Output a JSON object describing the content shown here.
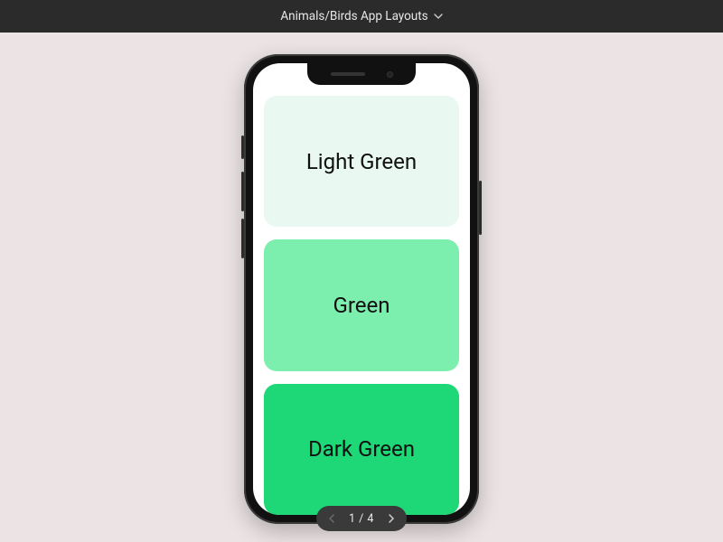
{
  "header": {
    "title": "Animals/Birds App Layouts"
  },
  "cards": [
    {
      "label": "Light Green",
      "color": "#e9f9f1"
    },
    {
      "label": "Green",
      "color": "#7ceeae"
    },
    {
      "label": "Dark Green",
      "color": "#1ed776"
    }
  ],
  "pager": {
    "current": 1,
    "total": 4,
    "display": "1 / 4"
  }
}
